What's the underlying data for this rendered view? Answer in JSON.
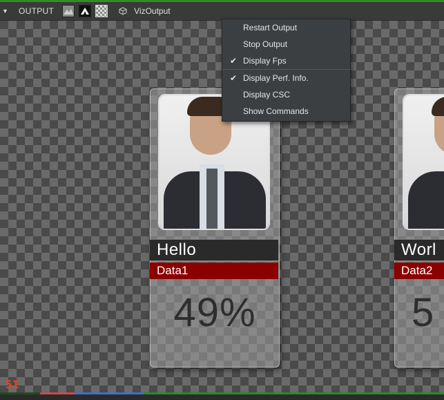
{
  "toolbar": {
    "title": "OUTPUT",
    "output_name": "VizOutput"
  },
  "menu": {
    "items": [
      {
        "label": "Restart Output",
        "checked": false
      },
      {
        "label": "Stop Output",
        "checked": false
      },
      {
        "label": "Display Fps",
        "checked": true
      },
      {
        "label": "Display Perf. Info.",
        "checked": true
      },
      {
        "label": "Display CSC",
        "checked": false
      },
      {
        "label": "Show Commands",
        "checked": false
      }
    ]
  },
  "cards": [
    {
      "name": "Hello",
      "data_label": "Data1",
      "value": "49%"
    },
    {
      "name": "Worl",
      "data_label": "Data2",
      "value": "5"
    }
  ],
  "overlay": {
    "fps": "51"
  },
  "colors": {
    "accent": "#2f8f1f",
    "data_bar": "#8b0000",
    "fps": "#ff3b1a"
  }
}
